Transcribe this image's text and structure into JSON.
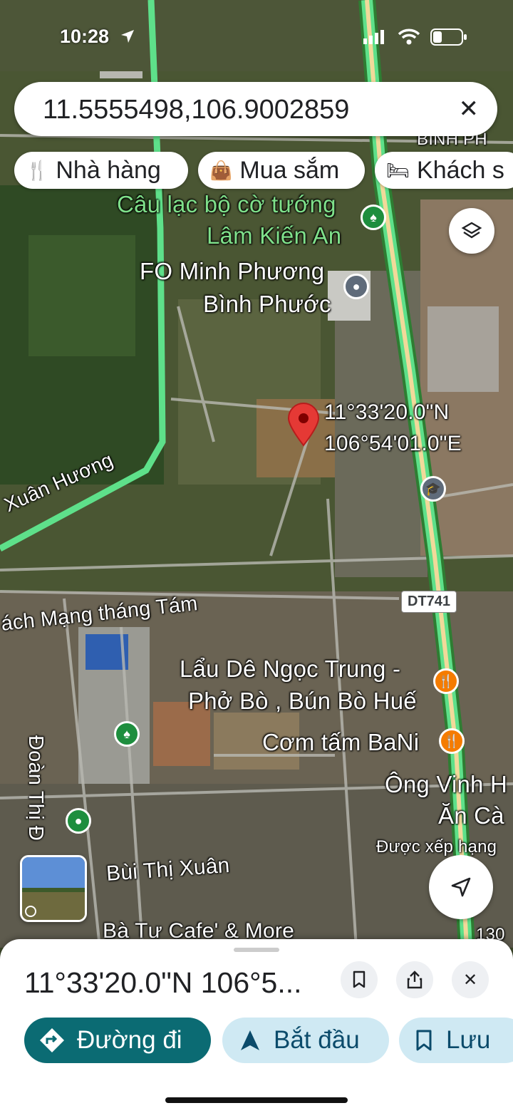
{
  "status": {
    "time": "10:28"
  },
  "search": {
    "query": "11.5555498,106.9002859"
  },
  "chips": [
    {
      "icon": "restaurant-icon",
      "label": "Nhà hàng"
    },
    {
      "icon": "shopping-bag-icon",
      "label": "Mua sắm"
    },
    {
      "icon": "bed-icon",
      "label": "Khách s"
    }
  ],
  "map": {
    "labels": {
      "club_line1": "Câu lạc bộ cờ tướng",
      "club_line2": "Lâm Kiến An",
      "fo_line1": "FO Minh Phương",
      "fo_line2": "Bình Phước",
      "pin_lat": "11°33'20.0\"N",
      "pin_lng": "106°54'01.0\"E",
      "road_xuan_huong": "Xuân Hương",
      "road_cmtt": "ách Mạng tháng Tám",
      "road_shield": "DT741",
      "lau_de_line1": "Lẩu Dê Ngọc Trung -",
      "lau_de_line2": "Phở Bò , Bún Bò Huế",
      "com_tam": "Cơm tấm BaNi",
      "ong_vinh_line1": "Ông Vinh H",
      "ong_vinh_line2": "Ăn Cà",
      "ranked": "Được xếp hạng",
      "road_doan_thi": "Đoàn Thị Đ",
      "road_bui_thi_xuan": "Bùi Thị Xuân",
      "ba_tu_cafe": "Bà Tư Cafe' & More",
      "binh_ph": "BÌNH PH",
      "num_130": "130"
    },
    "accent_road_color": "#5ee08a",
    "pin_color": "#e53935",
    "restaurant_color": "#f57c00"
  },
  "sheet": {
    "title": "11°33'20.0\"N 106°5...",
    "directions_label": "Đường đi",
    "start_label": "Bắt đầu",
    "save_label": "Lưu"
  }
}
